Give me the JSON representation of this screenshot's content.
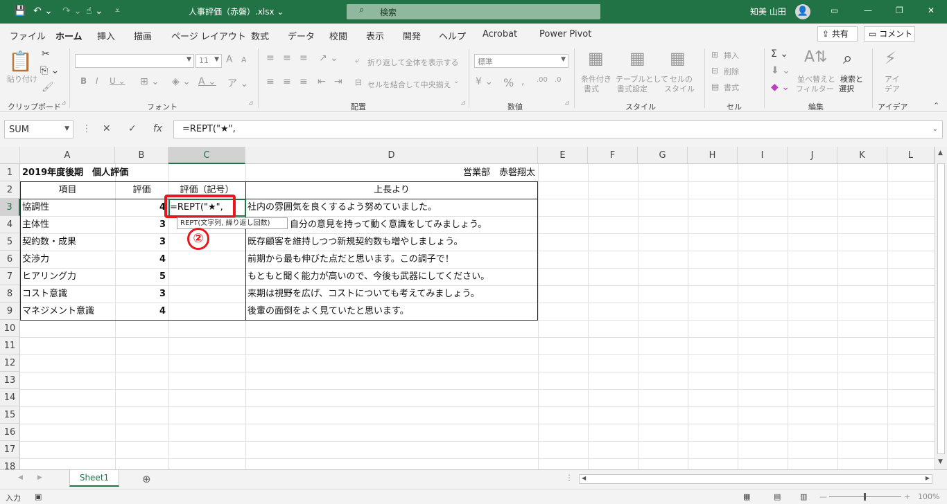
{
  "titlebar": {
    "filename": "人事評価（赤磐）.xlsx ⌄",
    "search_placeholder": "検索",
    "user_name": "知美 山田"
  },
  "tabs": [
    "ファイル",
    "ホーム",
    "挿入",
    "描画",
    "ページ レイアウト",
    "数式",
    "データ",
    "校閲",
    "表示",
    "開発",
    "ヘルプ",
    "Acrobat",
    "Power Pivot"
  ],
  "tab_actions": {
    "share": "共有",
    "comment": "コメント"
  },
  "ribbon": {
    "clipboard": {
      "label": "クリップボード",
      "paste": "貼り付け"
    },
    "font": {
      "label": "フォント",
      "font_size": "11"
    },
    "alignment": {
      "label": "配置",
      "wrap": "折り返して全体を表示する",
      "merge": "セルを結合して中央揃え"
    },
    "number": {
      "label": "数値",
      "format": "標準"
    },
    "styles": {
      "label": "スタイル",
      "cond1": "条件付き",
      "cond2": "書式",
      "table1": "テーブルとして",
      "table2": "書式設定",
      "cell1": "セルの",
      "cell2": "スタイル"
    },
    "cells": {
      "label": "セル",
      "insert": "挿入",
      "delete": "削除",
      "format": "書式"
    },
    "editing": {
      "label": "編集",
      "sort1": "並べ替えと",
      "sort2": "フィルター",
      "find1": "検索と",
      "find2": "選択"
    },
    "ideas": {
      "label": "アイデア",
      "ideas1": "アイ",
      "ideas2": "デア"
    }
  },
  "formula_bar": {
    "name_box": "SUM",
    "formula": "=REPT(\"★\","
  },
  "columns": [
    "A",
    "B",
    "C",
    "D",
    "E",
    "F",
    "G",
    "H",
    "I",
    "J",
    "K",
    "L"
  ],
  "rows": [
    "1",
    "2",
    "3",
    "4",
    "5",
    "6",
    "7",
    "8",
    "9",
    "10",
    "11",
    "12",
    "13",
    "14",
    "15",
    "16",
    "17",
    "18"
  ],
  "sheet": {
    "title": "2019年度後期　個人評価",
    "author": "営業部　赤磐翔太",
    "headers": {
      "item": "項目",
      "score": "評価",
      "mark": "評価（記号）",
      "comment": "上長より"
    },
    "editing_cell": "=REPT(\"★\",",
    "table": [
      {
        "item": "協調性",
        "score": "4",
        "comment": "社内の雰囲気を良くするよう努めていました。"
      },
      {
        "item": "主体性",
        "score": "3",
        "comment": "自分の意見を持って動く意識をしてみましょう。"
      },
      {
        "item": "契約数・成果",
        "score": "3",
        "comment": "既存顧客を維持しつつ新規契約数も増やしましょう。"
      },
      {
        "item": "交渉力",
        "score": "4",
        "comment": "前期から最も伸びた点だと思います。この調子で！"
      },
      {
        "item": "ヒアリング力",
        "score": "5",
        "comment": "もともと聞く能力が高いので、今後も武器にしてください。"
      },
      {
        "item": "コスト意識",
        "score": "3",
        "comment": "来期は視野を広げ、コストについても考えてみましょう。"
      },
      {
        "item": "マネジメント意識",
        "score": "4",
        "comment": "後輩の面倒をよく見ていたと思います。"
      }
    ]
  },
  "tooltip": "REPT(文字列, 繰り返し回数)",
  "annotation": "②",
  "sheet_tabs": [
    "Sheet1"
  ],
  "status": {
    "mode": "入力",
    "zoom": "100%"
  },
  "colors": {
    "brand": "#217346",
    "annotation": "#e8171d"
  }
}
